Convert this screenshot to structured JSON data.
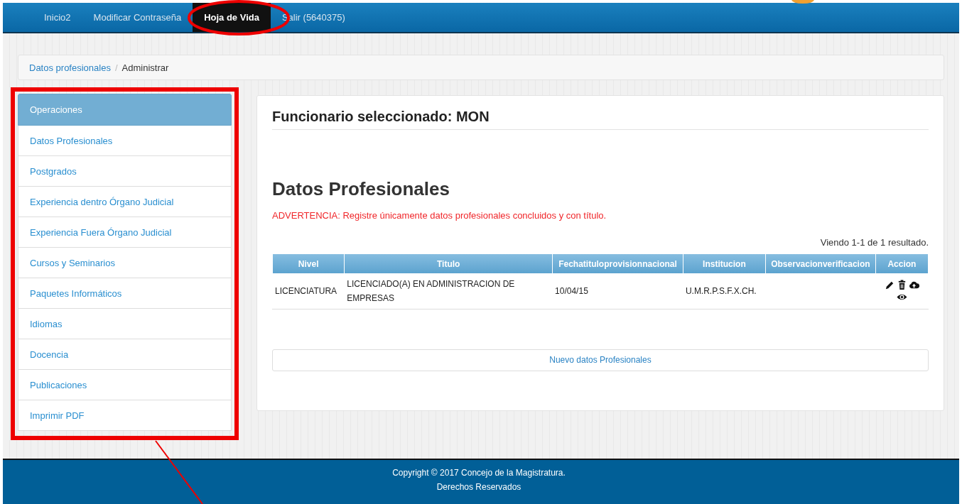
{
  "navbar": {
    "items": [
      {
        "label": "Inicio2",
        "selected": false
      },
      {
        "label": "Modificar Contraseña",
        "selected": false
      },
      {
        "label": "Hoja de Vida",
        "selected": true
      },
      {
        "label": "Salir (5640375)",
        "selected": false
      }
    ]
  },
  "breadcrumb": {
    "separator": "/",
    "items": [
      {
        "label": "Datos profesionales",
        "kind": "link"
      },
      {
        "label": "Administrar",
        "kind": "current"
      }
    ]
  },
  "sidebar": {
    "header": "Operaciones",
    "items": [
      "Datos Profesionales",
      "Postgrados",
      "Experiencia dentro Órgano Judicial",
      "Experiencia Fuera Órgano Judicial",
      "Cursos y Seminarios",
      "Paquetes Informáticos",
      "Idiomas",
      "Docencia",
      "Publicaciones",
      "Imprimir PDF"
    ]
  },
  "panel": {
    "title": "Funcionario seleccionado: MON",
    "heading": "Datos Profesionales",
    "warning": "ADVERTENCIA: Registre únicamente datos profesionales concluidos y con título.",
    "summary": "Viendo 1-1 de 1 resultado.",
    "table": {
      "columns": [
        "Nivel",
        "Titulo",
        "Fechatituloprovisionnacional",
        "Institucion",
        "Observacionverificacion",
        "Accion"
      ],
      "rows": [
        {
          "cells": [
            "LICENCIATURA",
            "LICENCIADO(A) EN ADMINISTRACION DE EMPRESAS",
            "10/04/15",
            "U.M.R.P.S.F.X.CH.",
            ""
          ],
          "actions": [
            {
              "kind": "edit"
            },
            {
              "kind": "delete"
            },
            {
              "kind": "upload"
            },
            {
              "kind": "view"
            }
          ]
        }
      ]
    },
    "new_button": "Nuevo datos Profesionales"
  },
  "footer": {
    "lines": [
      "Copyright © 2017 Concejo de la Magistratura.",
      "Derechos Reservados"
    ]
  }
}
